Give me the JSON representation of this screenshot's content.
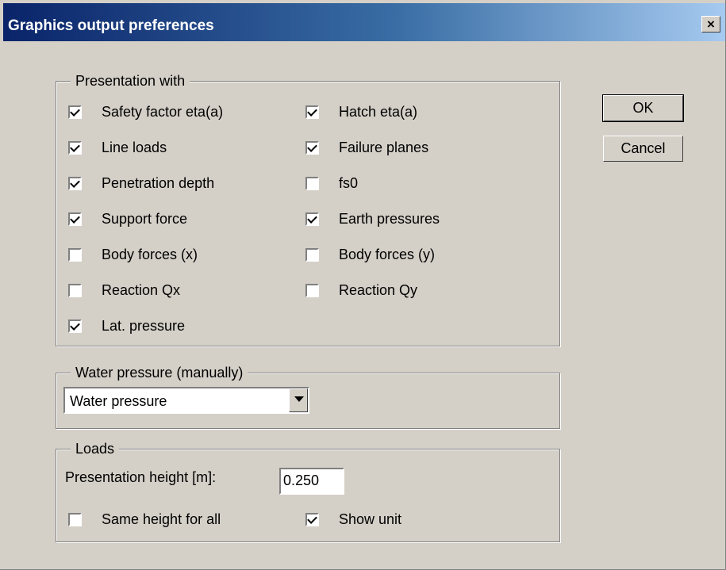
{
  "window": {
    "title": "Graphics output preferences",
    "close_glyph": "×"
  },
  "presentation": {
    "legend": "Presentation with",
    "left": [
      {
        "label": "Safety factor eta(a)",
        "checked": true
      },
      {
        "label": "Line loads",
        "checked": true
      },
      {
        "label": "Penetration depth",
        "checked": true
      },
      {
        "label": "Support force",
        "checked": true
      },
      {
        "label": "Body forces (x)",
        "checked": false
      },
      {
        "label": "Reaction Qx",
        "checked": false
      },
      {
        "label": "Lat. pressure",
        "checked": true
      }
    ],
    "right": [
      {
        "label": "Hatch eta(a)",
        "checked": true
      },
      {
        "label": "Failure planes",
        "checked": true
      },
      {
        "label": "fs0",
        "checked": false
      },
      {
        "label": "Earth pressures",
        "checked": true
      },
      {
        "label": "Body forces (y)",
        "checked": false
      },
      {
        "label": "Reaction Qy",
        "checked": false
      }
    ]
  },
  "water": {
    "legend": "Water pressure (manually)",
    "selected": "Water pressure"
  },
  "loads": {
    "legend": "Loads",
    "height_label": "Presentation height [m]:",
    "height_value": "0.250",
    "same_height": {
      "label": "Same height for all",
      "checked": false
    },
    "show_unit": {
      "label": "Show unit",
      "checked": true
    }
  },
  "buttons": {
    "ok": "OK",
    "cancel": "Cancel"
  }
}
